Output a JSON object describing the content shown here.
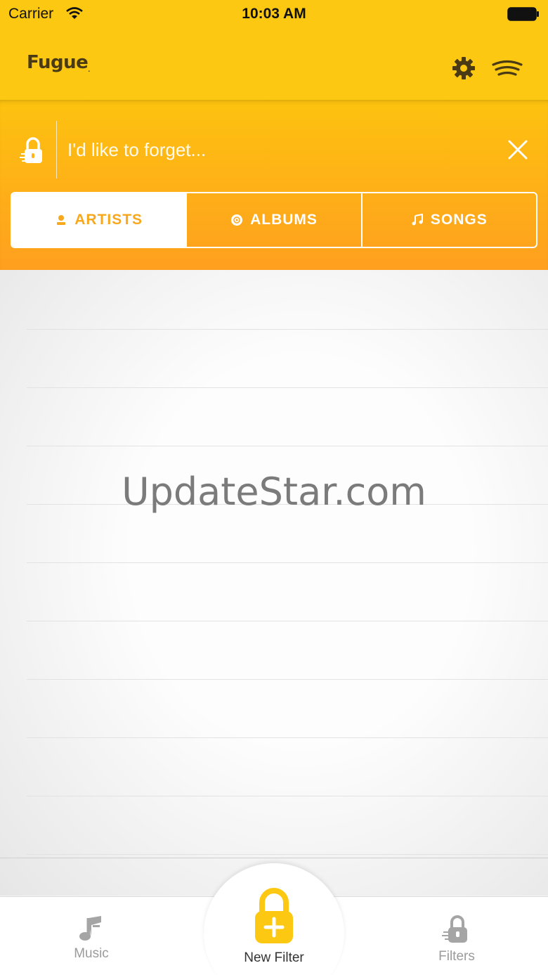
{
  "status_bar": {
    "carrier": "Carrier",
    "time": "10:03 AM"
  },
  "header": {
    "logo": "Fugue",
    "logo_mark": "."
  },
  "filter": {
    "placeholder": "I'd like to forget...",
    "tabs": [
      {
        "label": "ARTISTS",
        "icon": "person-icon",
        "active": true
      },
      {
        "label": "ALBUMS",
        "icon": "disc-icon",
        "active": false
      },
      {
        "label": "SONGS",
        "icon": "music-note-icon",
        "active": false
      }
    ]
  },
  "watermark": "UpdateStar.com",
  "tabbar": {
    "items": [
      {
        "label": "Music",
        "icon": "music-note-icon"
      },
      {
        "label": "New Filter",
        "icon": "lock-plus-icon"
      },
      {
        "label": "Filters",
        "icon": "lock-icon"
      }
    ]
  },
  "colors": {
    "accent": "#fdc812",
    "orange": "#ff9f1f",
    "tab_active_text": "#f7a81c"
  }
}
